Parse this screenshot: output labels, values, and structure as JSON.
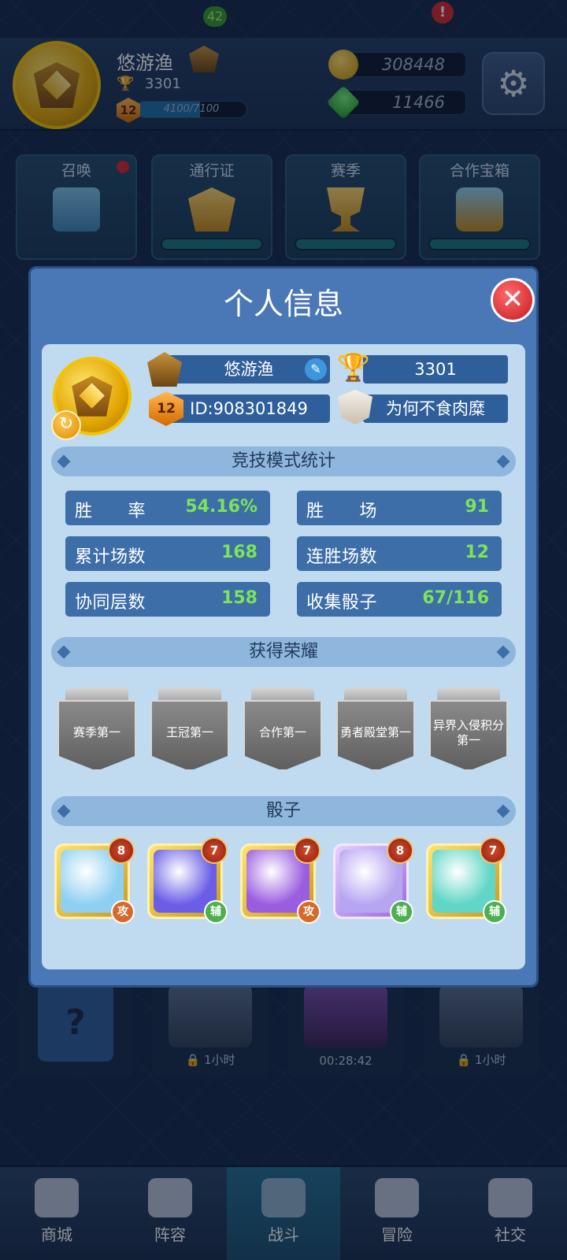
{
  "topbar": {
    "player_name": "悠游渔",
    "trophies": "3301",
    "level": "12",
    "xp_text": "4100/7100",
    "xp_fraction": 0.577,
    "gold": "308448",
    "gems": "11466"
  },
  "features": [
    {
      "label": "召唤"
    },
    {
      "label": "通行证"
    },
    {
      "label": "赛季"
    },
    {
      "label": "合作宝箱"
    }
  ],
  "chests": [
    {
      "time": ""
    },
    {
      "time": "1小时"
    },
    {
      "time": "00:28:42"
    },
    {
      "time": "1小时"
    }
  ],
  "nav": {
    "shop": "商城",
    "deck": "阵容",
    "battle": "战斗",
    "adventure": "冒险",
    "social": "社交",
    "deck_badge": "42",
    "adventure_badge": "!"
  },
  "modal": {
    "title": "个人信息",
    "name": "悠游渔",
    "trophies": "3301",
    "level": "12",
    "id": "ID:908301849",
    "clan": "为何不食肉糜",
    "stats_header": "竞技模式统计",
    "stats": {
      "win_rate_label": "胜　　率",
      "win_rate": "54.16%",
      "wins_label": "胜　　场",
      "wins": "91",
      "total_label": "累计场数",
      "total": "168",
      "streak_label": "连胜场数",
      "streak": "12",
      "coop_label": "协同层数",
      "coop": "158",
      "collect_label": "收集骰子",
      "collect": "67/116"
    },
    "honors_header": "获得荣耀",
    "honors": [
      "赛季第一",
      "王冠第一",
      "合作第一",
      "勇者殿堂第一",
      "异界入侵积分第一"
    ],
    "dice_header": "骰子",
    "dice": [
      {
        "level": "8",
        "role": "攻",
        "color": "#8fd0f2"
      },
      {
        "level": "7",
        "role": "辅",
        "color": "#6a5ee6"
      },
      {
        "level": "7",
        "role": "攻",
        "color": "#9a5de0"
      },
      {
        "level": "8",
        "role": "辅",
        "color": "#b6a6f0"
      },
      {
        "level": "7",
        "role": "辅",
        "color": "#5fd6c6"
      }
    ]
  }
}
